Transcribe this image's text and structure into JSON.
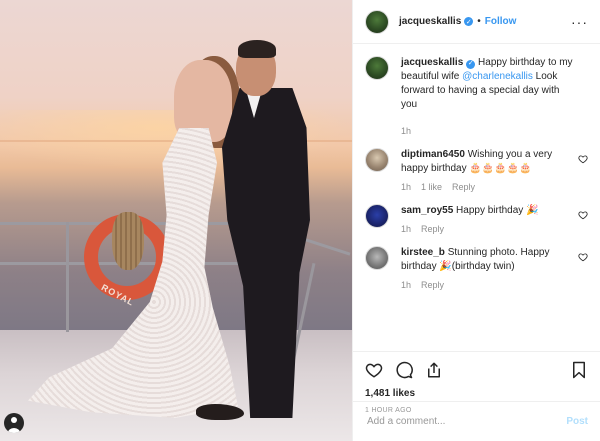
{
  "post": {
    "author": "jacqueskallis",
    "verified": true,
    "follow_label": "Follow",
    "separator": "•",
    "more_label": "···"
  },
  "caption": {
    "username": "jacqueskallis",
    "text_before": "Happy birthday to my beautiful wife ",
    "mention": "@charlenekallis",
    "text_after": " Look forward to having a special day with you",
    "time": "1h"
  },
  "comments": [
    {
      "username": "diptiman6450",
      "text": "Wishing you a very happy birthday 🎂🎂🎂🎂🎂",
      "time": "1h",
      "likes": "1 like",
      "reply": "Reply"
    },
    {
      "username": "sam_roy55",
      "text": "Happy birthday 🎉",
      "time": "1h",
      "likes": "",
      "reply": "Reply"
    },
    {
      "username": "kirstee_b",
      "text": "Stunning photo. Happy birthday 🎉(birthday twin)",
      "time": "1h",
      "likes": "",
      "reply": "Reply"
    }
  ],
  "engagement": {
    "likes": "1,481 likes",
    "timestamp": "1 HOUR AGO"
  },
  "compose": {
    "placeholder": "Add a comment...",
    "post_label": "Post"
  },
  "icons": {
    "like": "heart-icon",
    "comment": "comment-icon",
    "share": "share-icon",
    "save": "bookmark-icon",
    "tag": "user-tag-icon"
  },
  "colors": {
    "link": "#3897f0",
    "post_disabled": "#b2dffc",
    "secondary_text": "#8e8e8e"
  }
}
